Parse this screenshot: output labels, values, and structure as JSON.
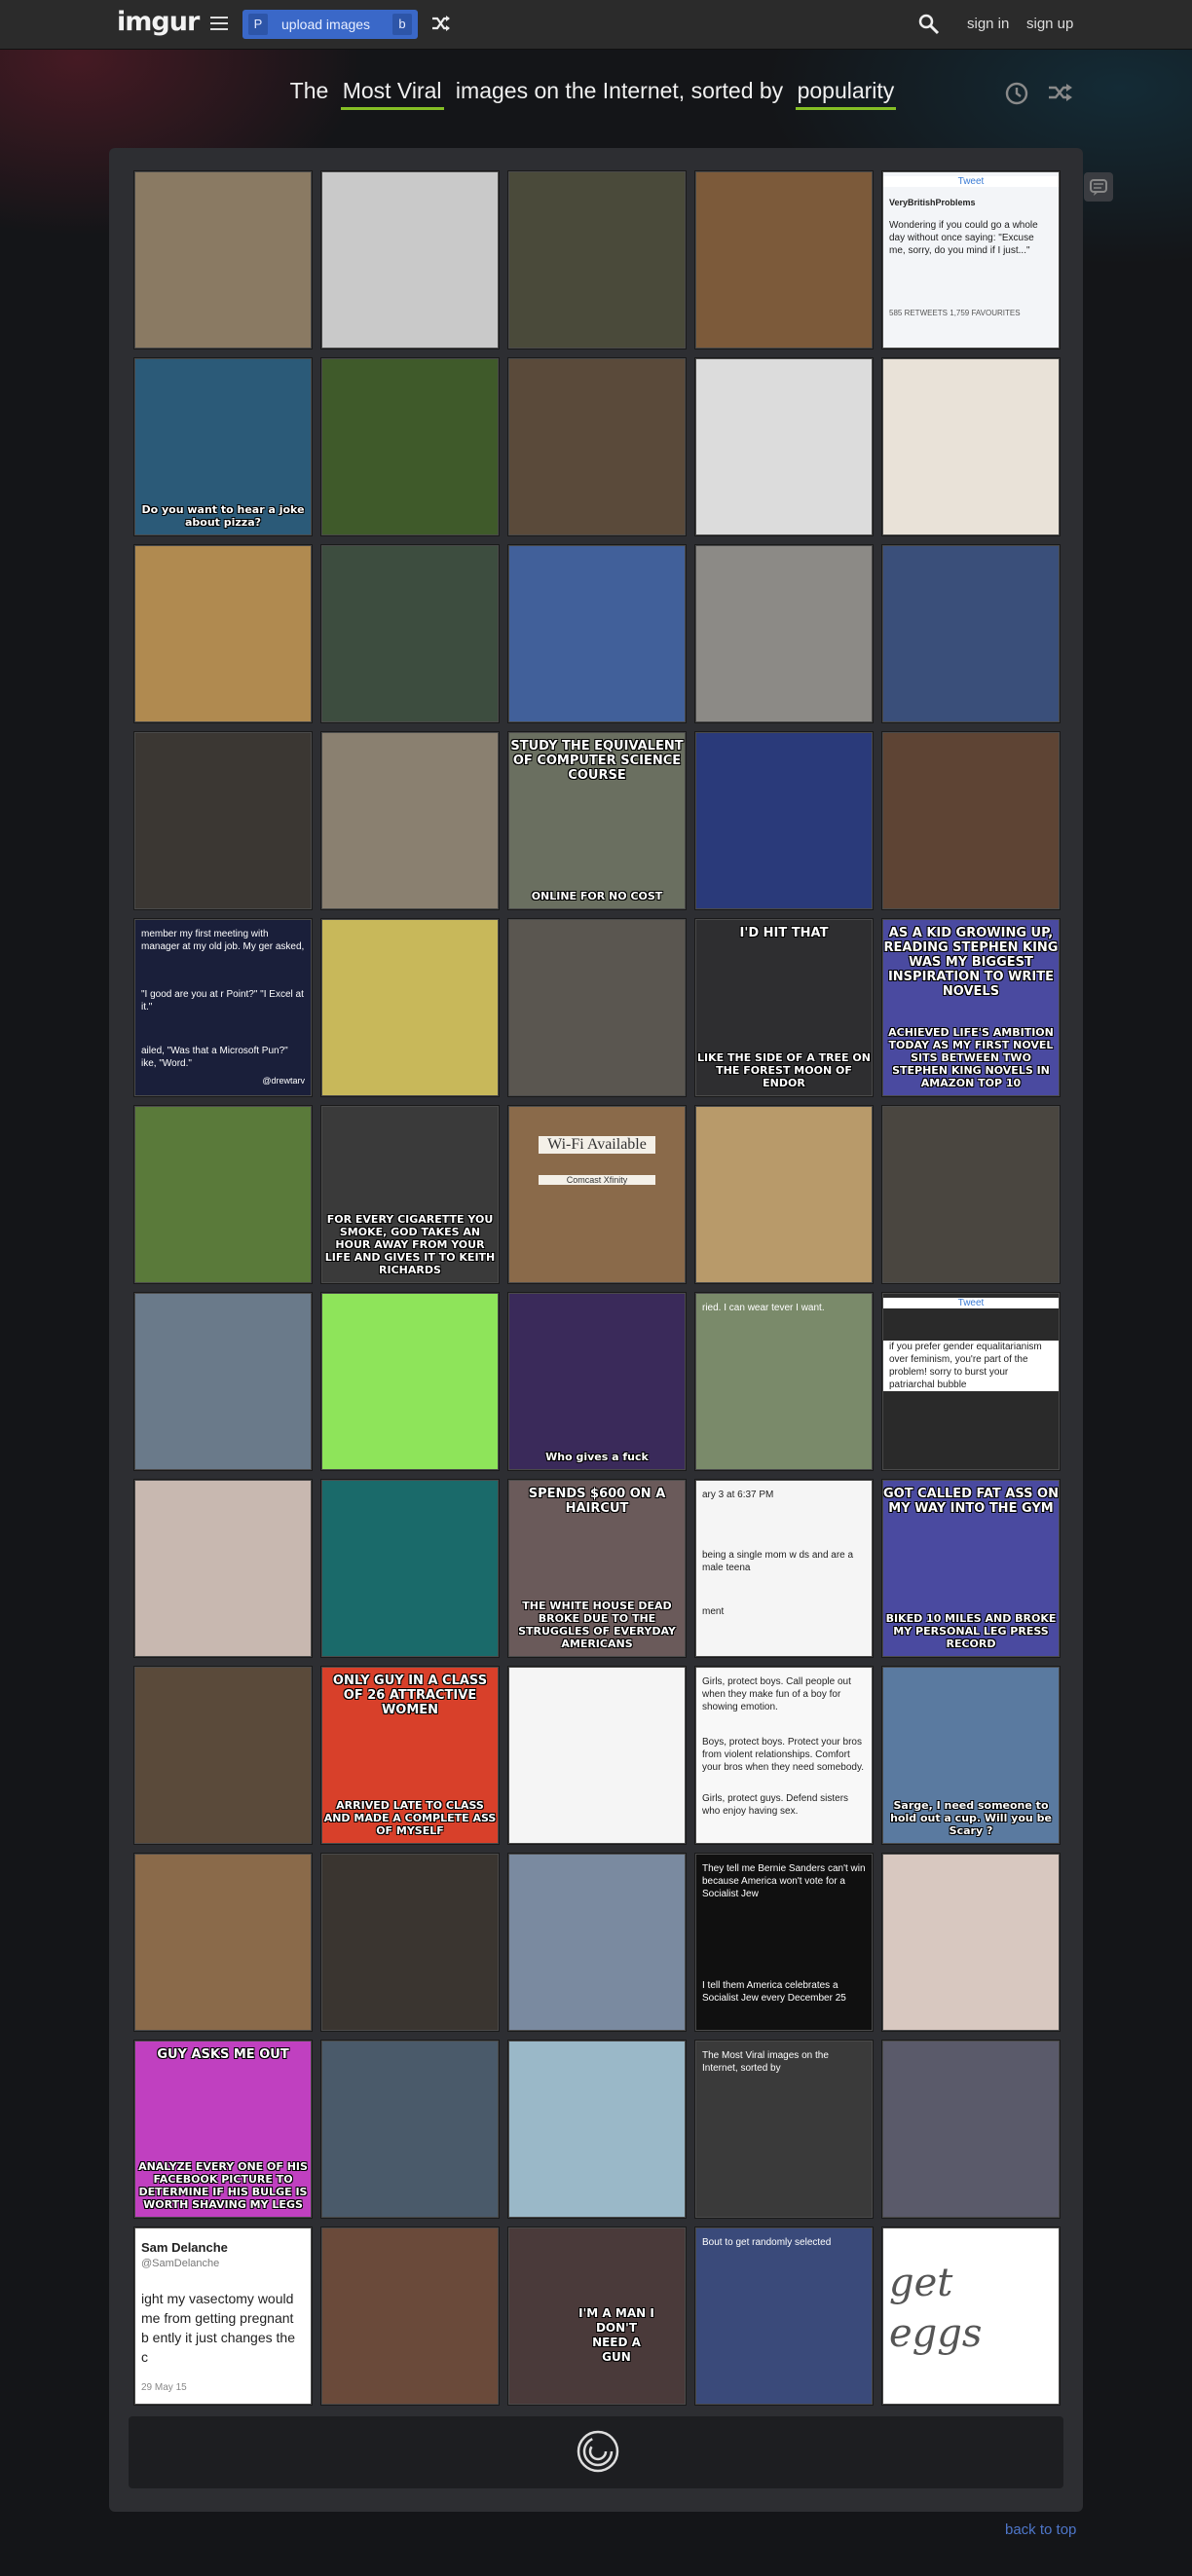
{
  "header": {
    "logo": "imgur",
    "upload_key_left": "P",
    "upload_label": "upload images",
    "upload_key_right": "b",
    "sign_in": "sign in",
    "sign_up": "sign up"
  },
  "headline": {
    "prefix": "The",
    "section": "Most Viral",
    "middle": "images on the Internet, sorted by",
    "sort": "popularity"
  },
  "tiles": [
    {
      "bg": "#8a7a63"
    },
    {
      "bg": "#c9c9c9"
    },
    {
      "bg": "#4a4a3a"
    },
    {
      "bg": "#7c5a3a"
    },
    {
      "bg": "#f3f5f8",
      "text_top": "Tweet",
      "text_handle": "VeryBritishProblems",
      "text_body": "Wondering if you could go a whole day without once saying: \"Excuse me, sorry, do you mind if I just...\"",
      "text_stats": "585 RETWEETS  1,759 FAVOURITES"
    },
    {
      "bg": "#2b5a78",
      "caption_bottom": "Do you want to hear a joke about pizza?"
    },
    {
      "bg": "#3f5a2a"
    },
    {
      "bg": "#5a4a3a"
    },
    {
      "bg": "#dcdcdc"
    },
    {
      "bg": "#e9e2d8"
    },
    {
      "bg": "#b08a50"
    },
    {
      "bg": "#3d4d3f"
    },
    {
      "bg": "#41609a"
    },
    {
      "bg": "#8c8a86"
    },
    {
      "bg": "#3a4f7a"
    },
    {
      "bg": "#3b3733"
    },
    {
      "bg": "#8a8070"
    },
    {
      "bg": "#6a6f60",
      "caption_top": "STUDY THE EQUIVALENT OF COMPUTER SCIENCE COURSE",
      "caption_bottom": "ONLINE FOR NO COST"
    },
    {
      "bg": "#2a3a7a"
    },
    {
      "bg": "#5e4434"
    },
    {
      "bg": "#1a1f3a",
      "plain_top": "member my first meeting with manager at my old job. My ger asked,",
      "plain_mid": "\"I good are you at r Point?\"  \"I Excel at it.\"",
      "plain_low": "ailed, \"Was that a Microsoft Pun?\"  ike, \"Word.\"",
      "handle": "@drewtarv"
    },
    {
      "bg": "#c8b85a"
    },
    {
      "bg": "#5a5650"
    },
    {
      "bg": "#2e2e30",
      "caption_top": "I'D HIT THAT",
      "caption_bottom": "LIKE THE SIDE OF A TREE ON THE FOREST MOON OF ENDOR"
    },
    {
      "bg": "#4a4aa0",
      "caption_top": "AS A KID GROWING UP, READING STEPHEN KING WAS MY BIGGEST INSPIRATION TO WRITE NOVELS",
      "caption_bottom": "ACHIEVED LIFE'S AMBITION TODAY AS MY FIRST NOVEL SITS BETWEEN TWO STEPHEN KING NOVELS IN AMAZON TOP 10"
    },
    {
      "bg": "#5a7a3a"
    },
    {
      "bg": "#3a3a3a",
      "caption_bottom": "FOR EVERY CIGARETTE YOU SMOKE, GOD TAKES AN HOUR AWAY FROM YOUR LIFE AND GIVES IT TO KEITH RICHARDS"
    },
    {
      "bg": "#8a6a4a",
      "sign_title": "Wi-Fi Available",
      "sign_sub": "Comcast Xfinity"
    },
    {
      "bg": "#b89a6a"
    },
    {
      "bg": "#4a4640"
    },
    {
      "bg": "#6a7a8a"
    },
    {
      "bg": "#8ee45a"
    },
    {
      "bg": "#3a2a5a",
      "caption_bottom": "Who gives a fuck"
    },
    {
      "bg": "#7a8a6a",
      "plain_top": "ried. I can wear tever I want."
    },
    {
      "bg": "#2a2a2a",
      "text_top": "Tweet",
      "text_body": "if you prefer gender equalitarianism over feminism, you're part of the problem! sorry to burst your patriarchal bubble"
    },
    {
      "bg": "#c8b8b0"
    },
    {
      "bg": "#1a6a6a"
    },
    {
      "bg": "#6a5a5a",
      "caption_top": "SPENDS $600 ON A HAIRCUT",
      "caption_bottom": "THE WHITE HOUSE DEAD BROKE DUE TO THE STRUGGLES OF EVERYDAY AMERICANS"
    },
    {
      "bg": "#f5f5f5",
      "plain_top": "ary 3 at 6:37 PM",
      "plain_mid": "being a single mom w ds and are a male teena",
      "plain_low": "ment"
    },
    {
      "bg": "#4a4aa0",
      "caption_top": "GOT CALLED FAT ASS ON MY WAY INTO THE GYM",
      "caption_bottom": "BIKED 10 MILES AND BROKE MY PERSONAL LEG PRESS RECORD"
    },
    {
      "bg": "#5a4a3a"
    },
    {
      "bg": "#d8402a",
      "caption_top": "ONLY GUY IN A CLASS OF 26 ATTRACTIVE WOMEN",
      "caption_bottom": "ARRIVED LATE TO CLASS AND MADE A COMPLETE ASS OF MYSELF"
    },
    {
      "bg": "#f5f5f5"
    },
    {
      "bg": "#f8f8f8",
      "plain_top": "Girls, protect boys. Call people out when they make fun of a boy for showing emotion.",
      "plain_mid": "Boys, protect boys. Protect your bros from violent relationships. Comfort your bros when they need somebody.",
      "plain_low": "Girls, protect guys. Defend sisters who enjoy having sex."
    },
    {
      "bg": "#5a7aa0",
      "caption_bottom": "Sarge, I need someone to hold out a cup. Will you be Scary ?"
    },
    {
      "bg": "#8a6a4a"
    },
    {
      "bg": "#3a3530"
    },
    {
      "bg": "#7a8aa0"
    },
    {
      "bg": "#101010",
      "plain_top": "They tell me Bernie Sanders can't win because America won't vote for a Socialist Jew",
      "plain_low": "I tell them America celebrates a Socialist Jew every December 25"
    },
    {
      "bg": "#d8c8c0"
    },
    {
      "bg": "#c040c0",
      "caption_top": "GUY ASKS ME OUT",
      "caption_bottom": "ANALYZE EVERY ONE OF HIS FACEBOOK PICTURE TO DETERMINE IF HIS BULGE IS WORTH SHAVING MY LEGS"
    },
    {
      "bg": "#4a5a6a"
    },
    {
      "bg": "#9ab8c8"
    },
    {
      "bg": "#3a3a3a",
      "plain_top": "The Most Viral images on the Internet, sorted by"
    },
    {
      "bg": "#5a5a6a"
    },
    {
      "bg": "#ffffff",
      "tw_name": "Sam Delanche",
      "tw_handle": "@SamDelanche",
      "tw_body": "ight my vasectomy would me from getting pregnant b ently it just changes the c",
      "tw_date": "29 May 15"
    },
    {
      "bg": "#6a4a3a"
    },
    {
      "bg": "#4a3a3a",
      "shirt": "I'M A MAN I DON'T NEED A GUN"
    },
    {
      "bg": "#3a4a7a",
      "plain_top": "Bout to get randomly selected"
    },
    {
      "bg": "#ffffff",
      "handwriting": "get eggs"
    }
  ],
  "back_to_top": "back to top"
}
